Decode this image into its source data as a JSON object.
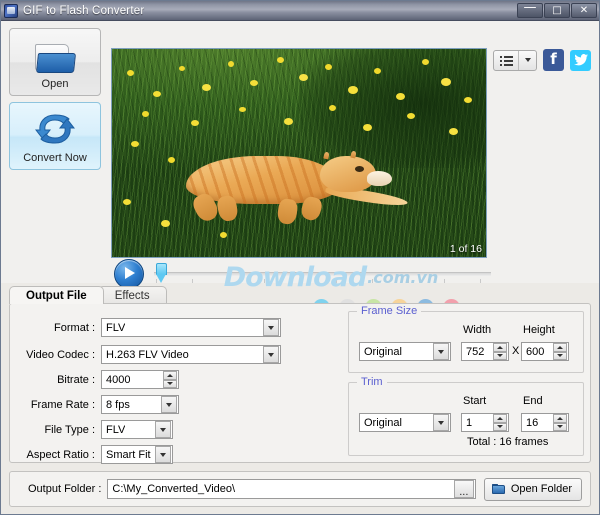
{
  "window": {
    "title": "GIF to Flash Converter",
    "icon": "app-icon",
    "minimize_label": "—",
    "maximize_label": "□",
    "close_label": "✕"
  },
  "sidebar": {
    "open_label": "Open",
    "convert_label": "Convert Now"
  },
  "toolbar": {
    "list_icon": "list-icon",
    "dropdown_caret": "▾",
    "facebook_label": "f",
    "twitter_label": "🐦"
  },
  "preview": {
    "frame_counter": "1 of 16",
    "image_description": "orange tabby cat leaping through green grass with yellow dandelions"
  },
  "player": {
    "play_label": "▶",
    "slider_value": 0,
    "watermark_main": "Download",
    "watermark_sub": ".com.vn"
  },
  "color_dots": [
    "#7fd2ee",
    "#e0e0e0",
    "#c8e5a6",
    "#f7d49a",
    "#8cbbe0",
    "#f2a0ac"
  ],
  "tabs": [
    {
      "label": "Output File",
      "active": true
    },
    {
      "label": "Effects",
      "active": false
    }
  ],
  "output_file": {
    "fields": [
      {
        "label": "Format :",
        "value": "FLV",
        "type": "select"
      },
      {
        "label": "Video Codec :",
        "value": "H.263 FLV Video",
        "type": "select"
      },
      {
        "label": "Bitrate :",
        "value": "4000",
        "type": "spin"
      },
      {
        "label": "Frame Rate :",
        "value": "8 fps",
        "type": "select"
      },
      {
        "label": "File Type :",
        "value": "FLV",
        "type": "select"
      },
      {
        "label": "Aspect Ratio :",
        "value": "Smart Fit",
        "type": "select"
      }
    ]
  },
  "frame_size": {
    "title": "Frame Size",
    "preset": "Original",
    "width_label": "Width",
    "width_value": "752",
    "times_label": "X",
    "height_label": "Height",
    "height_value": "600"
  },
  "trim": {
    "title": "Trim",
    "preset": "Original",
    "start_label": "Start",
    "start_value": "1",
    "end_label": "End",
    "end_value": "16",
    "total_label": "Total : 16 frames"
  },
  "bottom": {
    "output_folder_label": "Output Folder :",
    "output_folder_path": "C:\\My_Converted_Video\\",
    "browse_label": "...",
    "open_folder_label": "Open Folder"
  },
  "colors": {
    "titlebar_text": "#ffffff",
    "group_title": "#5a5fd0",
    "accent_blue": "#2f7fd0",
    "facebook": "#3b5998",
    "twitter": "#33ccff"
  }
}
